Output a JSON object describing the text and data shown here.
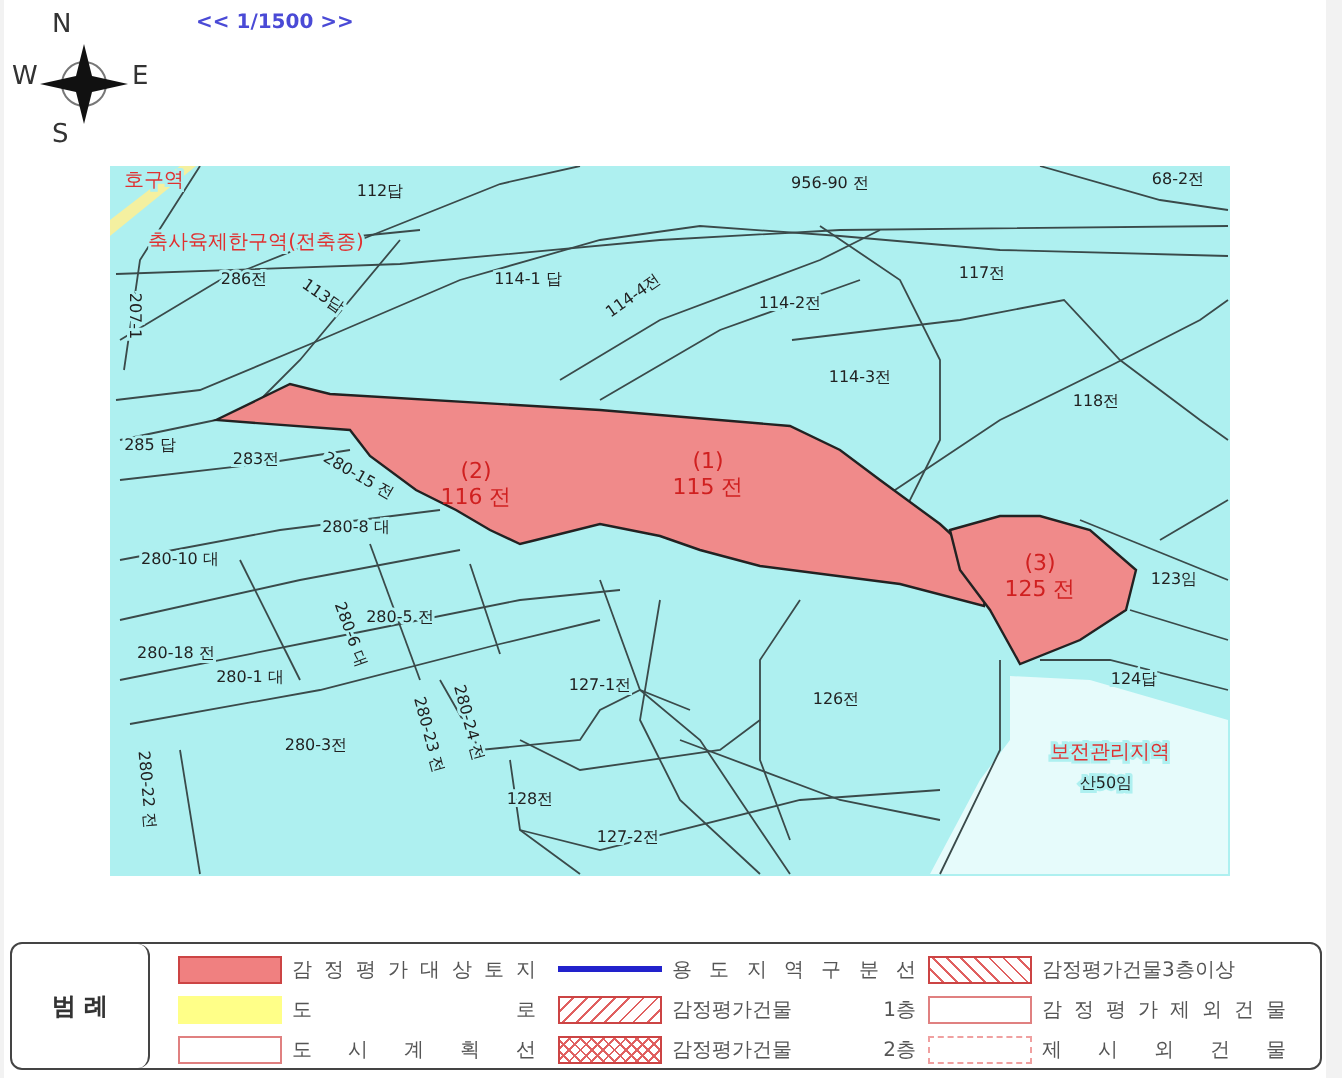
{
  "scale": {
    "label": "<< 1/1500 >>"
  },
  "compass": {
    "north": "N",
    "west": "W",
    "east": "E",
    "south": "S"
  },
  "map": {
    "zones": [
      {
        "label": "호구역"
      },
      {
        "label": "축사육제한구역(전축종)"
      },
      {
        "label": "보전관리지역"
      }
    ],
    "targets": [
      {
        "number": "(2)",
        "label": "116 전"
      },
      {
        "number": "(1)",
        "label": "115 전"
      },
      {
        "number": "(3)",
        "label": "125 전"
      }
    ],
    "parcels": [
      "112답",
      "286전",
      "113답",
      "114-1 답",
      "114-4전",
      "956-90 전",
      "68-2전",
      "117전",
      "114-2전",
      "114-3전",
      "118전",
      "285 답",
      "283전",
      "280-15 전",
      "280-8 대",
      "280-10 대",
      "280-18 전",
      "280-1 대",
      "280-6 대",
      "280-5 전",
      "127-1전",
      "280-24 전",
      "280-23 전",
      "280-3전",
      "128전",
      "127-2전",
      "280-22 전",
      "126전",
      "123임",
      "124답",
      "산50임",
      "207-1"
    ]
  },
  "legend": {
    "title": "범 례",
    "items": [
      {
        "kind": "solid",
        "label": "감 정 평 가 대 상 토 지"
      },
      {
        "kind": "blue-line",
        "label": "용 도 지 역 구 분 선"
      },
      {
        "kind": "hatch-circle",
        "label": "감정평가건물3층이상"
      },
      {
        "kind": "yellow",
        "label": "도 로"
      },
      {
        "kind": "hatch",
        "label": "감정평가건물 1층"
      },
      {
        "kind": "outline",
        "label": "감 정 평 가 제 외 건 물"
      },
      {
        "kind": "outline",
        "label": "도 시 계 획 선"
      },
      {
        "kind": "crosshatch",
        "label": "감정평가건물 2층"
      },
      {
        "kind": "dotted",
        "label": "제 시 외 건 물"
      }
    ]
  }
}
